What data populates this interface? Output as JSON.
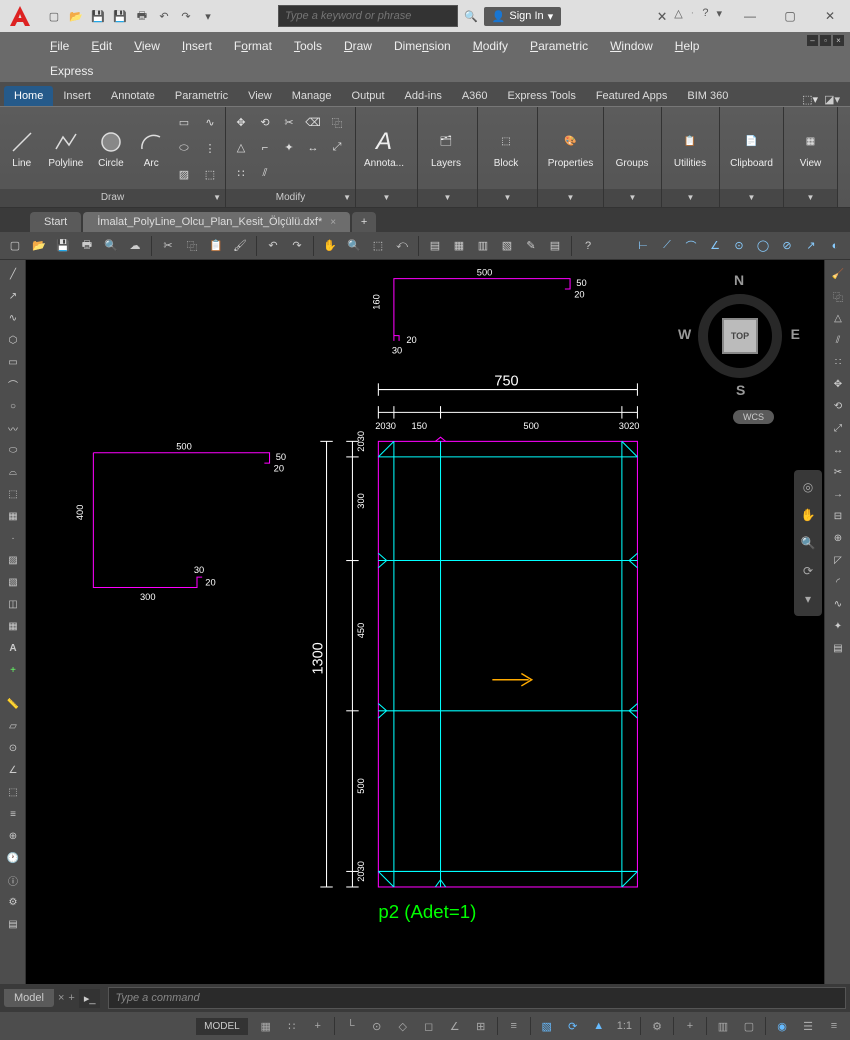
{
  "titlebar": {
    "search_placeholder": "Type a keyword or phrase",
    "signin": "Sign In"
  },
  "menus": [
    "File",
    "Edit",
    "View",
    "Insert",
    "Format",
    "Tools",
    "Draw",
    "Dimension",
    "Modify",
    "Parametric",
    "Window",
    "Help"
  ],
  "menus2": [
    "Express"
  ],
  "ribbon": {
    "tabs": [
      "Home",
      "Insert",
      "Annotate",
      "Parametric",
      "View",
      "Manage",
      "Output",
      "Add-ins",
      "A360",
      "Express Tools",
      "Featured Apps",
      "BIM 360"
    ],
    "active": "Home",
    "draw": {
      "line": "Line",
      "polyline": "Polyline",
      "circle": "Circle",
      "arc": "Arc",
      "title": "Draw"
    },
    "modify": {
      "title": "Modify"
    },
    "panels": [
      "Annota...",
      "Layers",
      "Block",
      "Properties",
      "Groups",
      "Utilities",
      "Clipboard",
      "View"
    ]
  },
  "tabs": {
    "start": "Start",
    "file": "İmalat_PolyLine_Olcu_Plan_Kesit_Ölçülü.dxf*"
  },
  "viewcube": {
    "top": "TOP",
    "n": "N",
    "s": "S",
    "e": "E",
    "w": "W",
    "wcs": "WCS"
  },
  "command": {
    "placeholder": "Type a command"
  },
  "model_tab": "Model",
  "status": {
    "model": "MODEL",
    "scale": "1:1"
  },
  "drawing": {
    "sec1": {
      "w": "500",
      "h": "160",
      "d30": "30",
      "d20": "20",
      "d50": "50"
    },
    "sec2": {
      "w": "500",
      "h": "400",
      "w2": "300",
      "d30": "30",
      "d20": "20",
      "d50": "50"
    },
    "main": {
      "w": "750",
      "h": "1300",
      "top_dims": [
        "2030",
        "150",
        "500",
        "3020"
      ],
      "left_dims": [
        "2030",
        "300",
        "450",
        "500",
        "2030"
      ],
      "label": "p2 (Adet=1)"
    }
  }
}
